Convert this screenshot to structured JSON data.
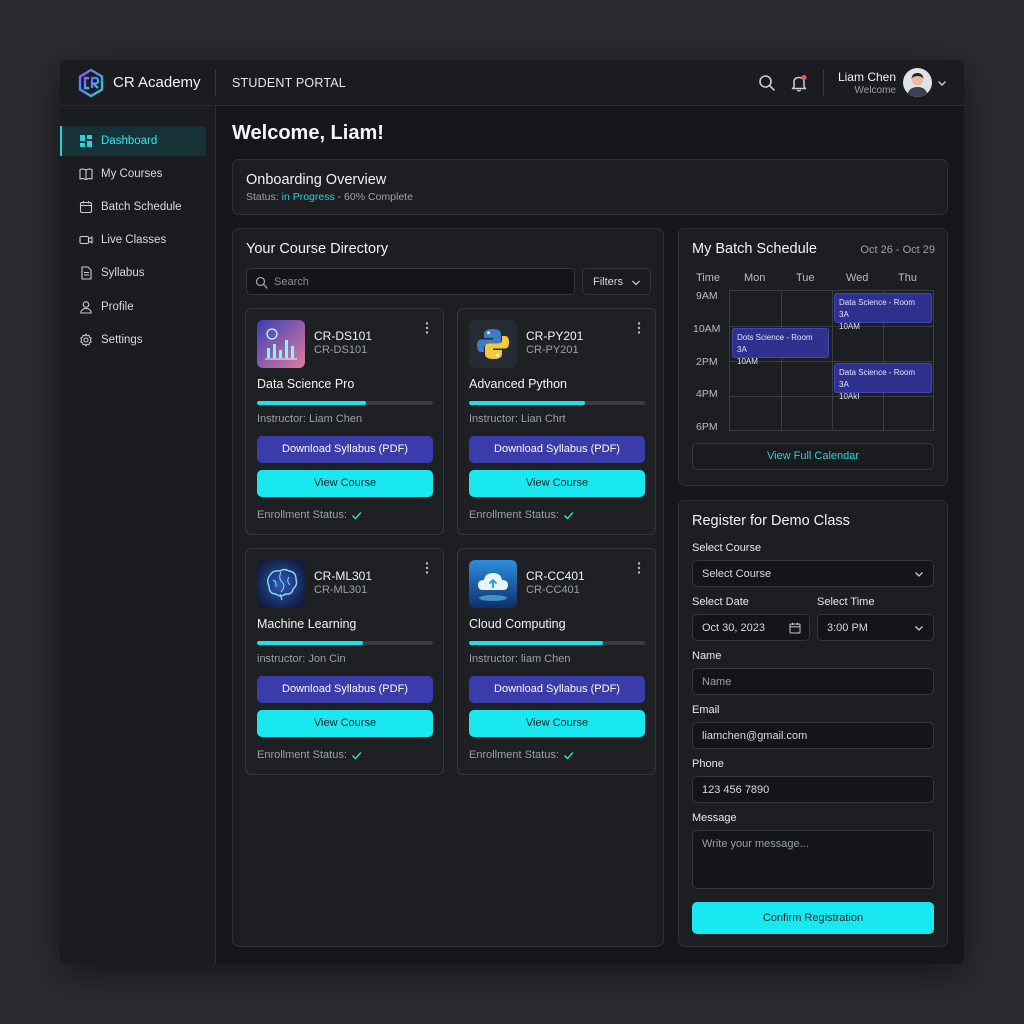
{
  "app": {
    "brand": "CR Academy",
    "section": "STUDENT PORTAL"
  },
  "user": {
    "name": "Liam Chen",
    "subtitle": "Welcome"
  },
  "sidebar": {
    "items": [
      {
        "label": "Dashboard",
        "icon": "dashboard-icon",
        "active": true
      },
      {
        "label": "My Courses",
        "icon": "book-icon"
      },
      {
        "label": "Batch Schedule",
        "icon": "calendar-icon"
      },
      {
        "label": "Live Classes",
        "icon": "video-icon"
      },
      {
        "label": "Syllabus",
        "icon": "document-icon"
      },
      {
        "label": "Profile",
        "icon": "user-icon"
      },
      {
        "label": "Settings",
        "icon": "gear-icon"
      }
    ]
  },
  "main": {
    "welcome": "Welcome, Liam!",
    "onboarding": {
      "title": "Onboarding Overview",
      "status_prefix": "Status: ",
      "status_value": "in Progress",
      "status_suffix": " - 60% Complete"
    }
  },
  "directory": {
    "title": "Your Course Directory",
    "search_placeholder": "Search",
    "filters_label": "Filters",
    "cards": [
      {
        "code": "CR-DS101",
        "code_sub": "CR-DS101",
        "name": "Data Science Pro",
        "progress": 0.62,
        "instructor": "Instructor: Liam Chen",
        "download_label": "Download Syllabus (PDF)",
        "view_label": "View Course",
        "enrollment_label": "Enrollment Status:",
        "thumb": "chart-thumbnail"
      },
      {
        "code": "CR-PY201",
        "code_sub": "CR-PY201",
        "name": "Advanced Python",
        "progress": 0.66,
        "instructor": "Instructor: Lian Chrt",
        "download_label": "Download Syllabus (PDF)",
        "view_label": "View Course",
        "enrollment_label": "Enrollment Status:",
        "thumb": "python-logo"
      },
      {
        "code": "CR-ML301",
        "code_sub": "CR-ML301",
        "name": "Machine Learning",
        "progress": 0.6,
        "instructor": "instructor: Jon Cin",
        "download_label": "Download Syllabus (PDF)",
        "view_label": "View Course",
        "enrollment_label": "Enrollment Status:",
        "thumb": "brain-thumbnail"
      },
      {
        "code": "CR-CC401",
        "code_sub": "CR-CC401",
        "name": "Cloud Computing",
        "progress": 0.76,
        "instructor": "Instructor: liam Chen",
        "download_label": "Download Syllabus (PDF)",
        "view_label": "View Course",
        "enrollment_label": "Enrollment Status:",
        "thumb": "cloud-thumbnail"
      }
    ]
  },
  "schedule": {
    "title": "My Batch Schedule",
    "range": "Oct 26 - Oct 29",
    "time_header": "Time",
    "days": [
      "Mon",
      "Tue",
      "Wed",
      "Thu"
    ],
    "times": [
      "9AM",
      "10AM",
      "2PM",
      "4PM",
      "6PM"
    ],
    "events": [
      {
        "day": "Wed",
        "row": 0,
        "line1": "Data Science - Room 3A",
        "line2": "10AM"
      },
      {
        "day": "Mon",
        "row": 1,
        "line1": "Dots Science - Room 3A",
        "line2": "10AM"
      },
      {
        "day": "Wed",
        "row": 2,
        "line1": "Data Science - Room 3A",
        "line2": "10AkI"
      }
    ],
    "full_calendar_label": "View Full Calendar"
  },
  "demo": {
    "title": "Register for Demo Class",
    "course_label": "Select Course",
    "course_value": "Select Course",
    "date_label": "Select Date",
    "date_value": "Oct 30, 2023",
    "time_label": "Select Time",
    "time_value": "3:00 PM",
    "name_label": "Name",
    "name_placeholder": "Name",
    "email_label": "Email",
    "email_value": "liamchen@gmail.com",
    "phone_label": "Phone",
    "phone_value": "123 456 7890",
    "message_label": "Message",
    "message_placeholder": "Write your message...",
    "confirm_label": "Confirm Registration"
  },
  "colors": {
    "accent": "#1ae8f0",
    "primary_button": "#3b3cab",
    "background": "#16171a",
    "notification_dot": "#ff4d4f"
  }
}
